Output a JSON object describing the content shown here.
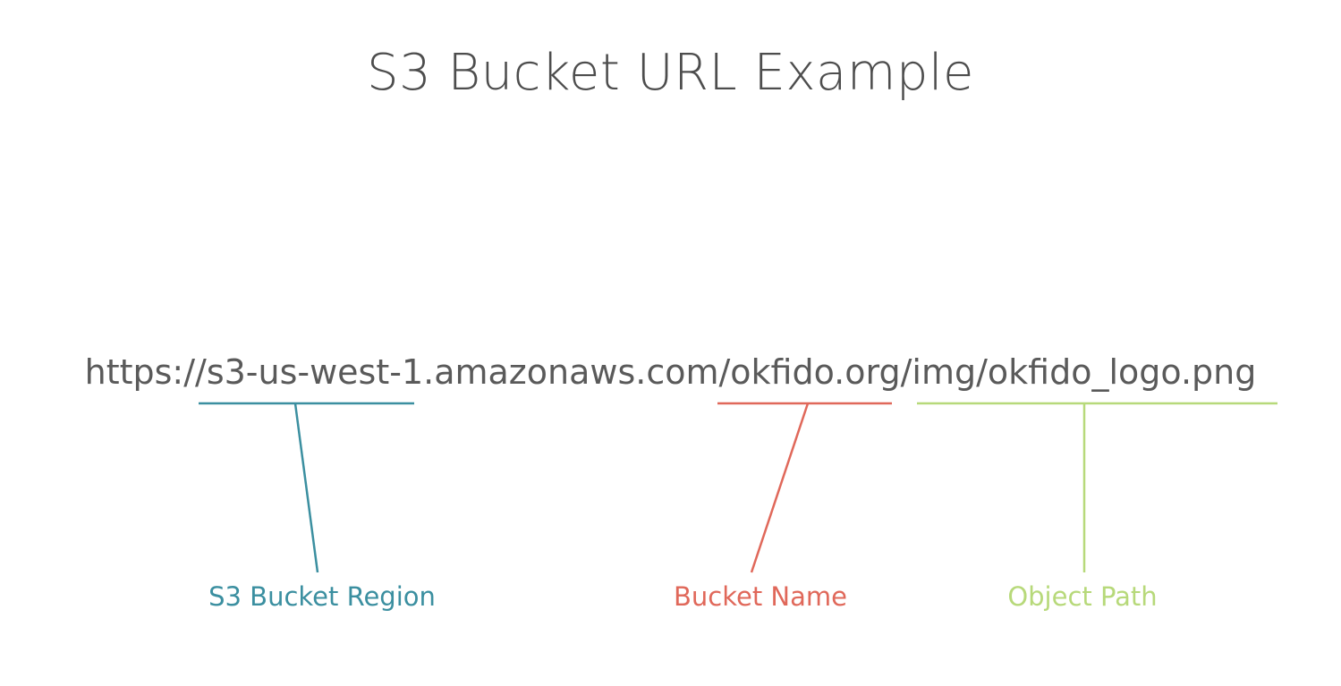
{
  "slide": {
    "title": "S3 Bucket URL Example",
    "url": "https://s3-us-west-1.amazonaws.com/okfido.org/img/okfido_logo.png"
  },
  "annotations": [
    {
      "label": "S3 Bucket Region",
      "color": "#3b8fa0"
    },
    {
      "label": "Bucket Name",
      "color": "#e0685a"
    },
    {
      "label": "Object Path",
      "color": "#b7d97a"
    }
  ]
}
